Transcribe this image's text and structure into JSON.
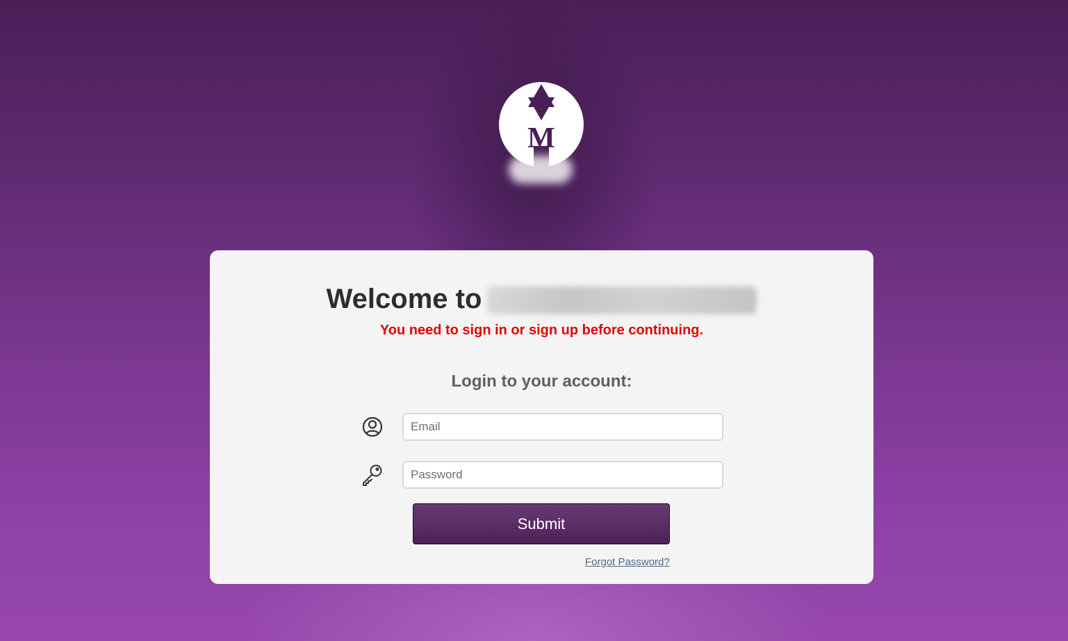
{
  "colors": {
    "background_top": "#4a1f57",
    "background_bottom": "#9848ac",
    "card": "#f4f4f4",
    "alert": "#e60000",
    "submit_button": "#5a2c64",
    "link": "#4a6a8a"
  },
  "logo": {
    "icon": "star-m-logo-icon",
    "letter": "M"
  },
  "welcome": {
    "prefix": "Welcome to"
  },
  "alert": {
    "message": "You need to sign in or sign up before continuing."
  },
  "login": {
    "heading": "Login to your account:",
    "email": {
      "icon": "user-circle-icon",
      "placeholder": "Email",
      "value": ""
    },
    "password": {
      "icon": "key-icon",
      "placeholder": "Password",
      "value": ""
    },
    "submit_label": "Submit",
    "forgot_label": "Forgot Password?"
  }
}
